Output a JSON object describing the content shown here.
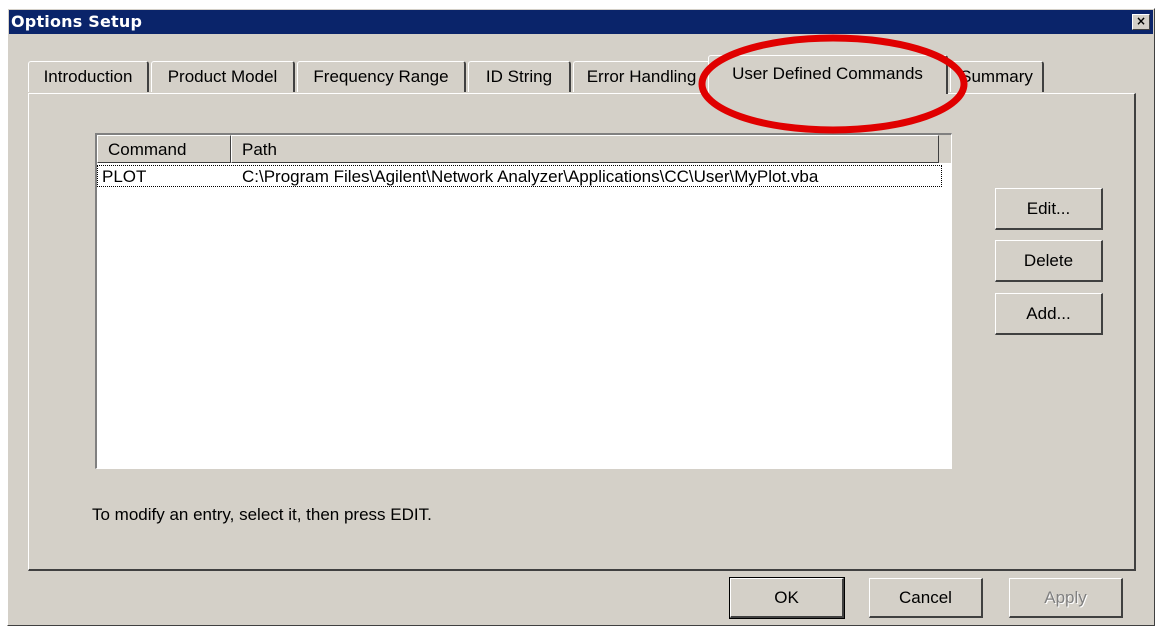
{
  "window": {
    "title": "Options Setup",
    "close_label": "×"
  },
  "tabs": [
    {
      "label": "Introduction",
      "active": false
    },
    {
      "label": "Product Model",
      "active": false
    },
    {
      "label": "Frequency Range",
      "active": false
    },
    {
      "label": "ID String",
      "active": false
    },
    {
      "label": "Error Handling",
      "active": false
    },
    {
      "label": "User Defined Commands",
      "active": true
    },
    {
      "label": "Summary",
      "active": false
    }
  ],
  "list": {
    "columns": [
      "Command",
      "Path"
    ],
    "rows": [
      {
        "command": "PLOT",
        "path": "C:\\Program Files\\Agilent\\Network Analyzer\\Applications\\CC\\User\\MyPlot.vba"
      }
    ]
  },
  "side_buttons": {
    "edit": "Edit...",
    "delete": "Delete",
    "add": "Add..."
  },
  "hint": "To modify an entry, select it, then press EDIT.",
  "footer_buttons": {
    "ok": "OK",
    "cancel": "Cancel",
    "apply": "Apply"
  },
  "colors": {
    "titlebar": "#0a246a",
    "face": "#d4d0c8",
    "highlight_ring": "#e00000"
  }
}
